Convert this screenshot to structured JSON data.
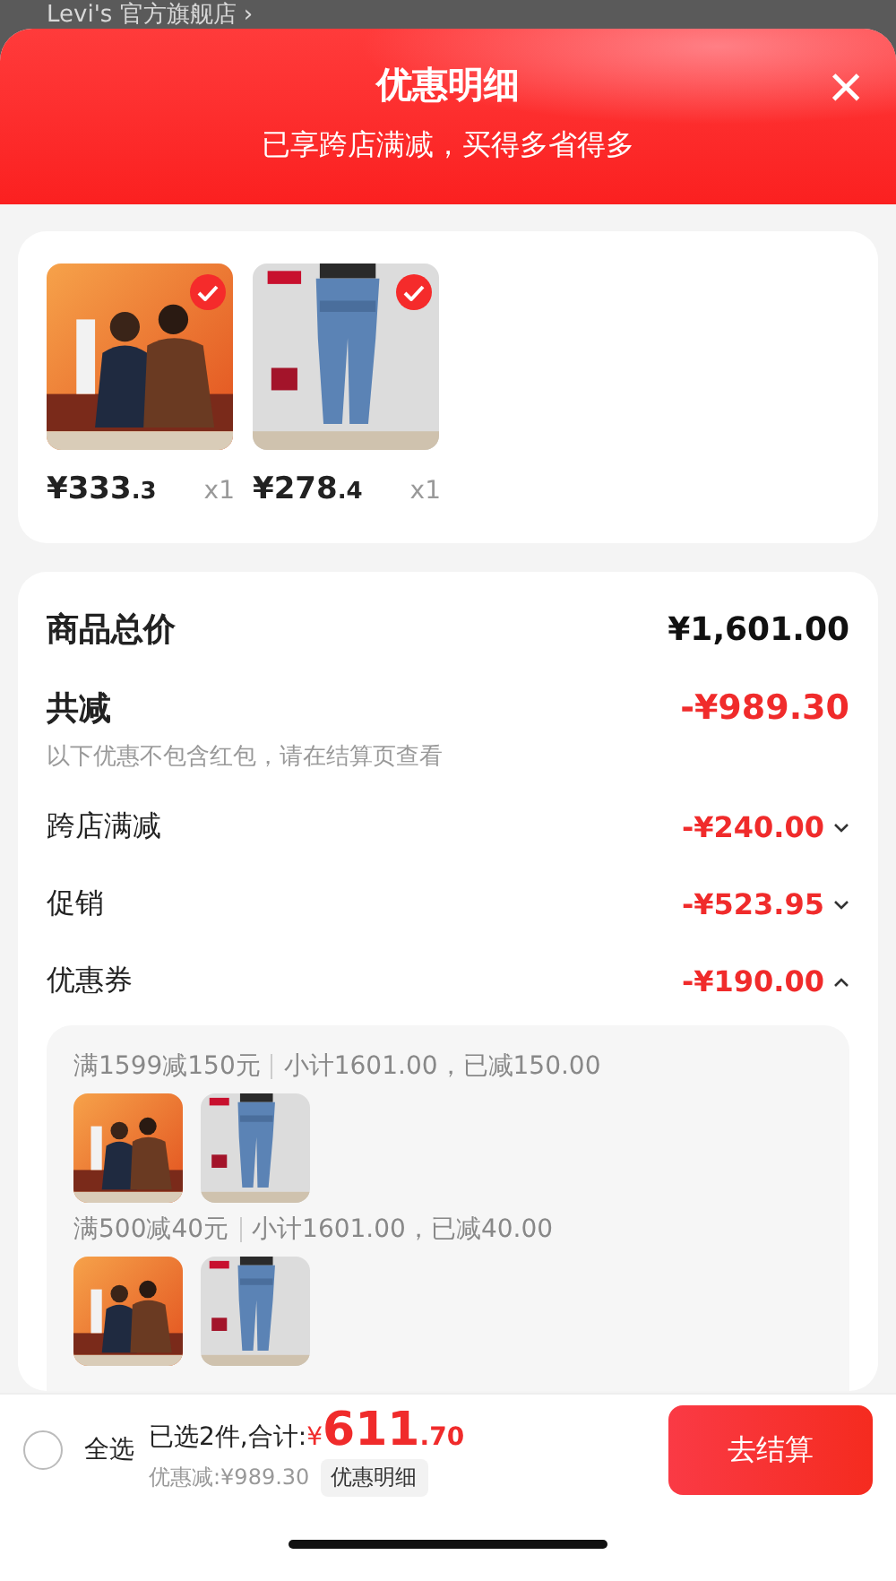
{
  "background_store": {
    "name": "Levi's 官方旗舰店 ›"
  },
  "sheet": {
    "title": "优惠明细",
    "subtitle": "已享跨店满减，买得多省得多",
    "close": "×"
  },
  "products": [
    {
      "kind": "picture",
      "selected": true,
      "price": "¥333",
      "price_decimal": ".3",
      "quantity": "x1"
    },
    {
      "kind": "picture",
      "selected": true,
      "price": "¥278",
      "price_decimal": ".4",
      "quantity": "x1"
    }
  ],
  "summary": {
    "total_label": "商品总价",
    "total_value": "¥1,601.00",
    "discount_label": "共减",
    "discount_value": "-¥989.30",
    "note": "以下优惠不包含红包，请在结算页查看"
  },
  "discount_rows": [
    {
      "label": "跨店满减",
      "value": "-¥240.00",
      "expanded": false
    },
    {
      "label": "促销",
      "value": "-¥523.95",
      "expanded": false
    },
    {
      "label": "优惠券",
      "value": "-¥190.00",
      "expanded": true
    }
  ],
  "coupon_groups": [
    {
      "rule": "满1599减150元",
      "detail": "小计1601.00，已减150.00"
    },
    {
      "rule": "满500减40元",
      "detail": "小计1601.00，已减40.00"
    }
  ],
  "footer": {
    "select_all": {
      "label": "全选",
      "checked": false
    },
    "total_label": "已选2件,合计:",
    "currency": "¥",
    "amount": "611",
    "amount_decimal": ".70",
    "saved": "优惠减:¥989.30",
    "details_button": "优惠明细",
    "checkout_button": "去结算"
  }
}
